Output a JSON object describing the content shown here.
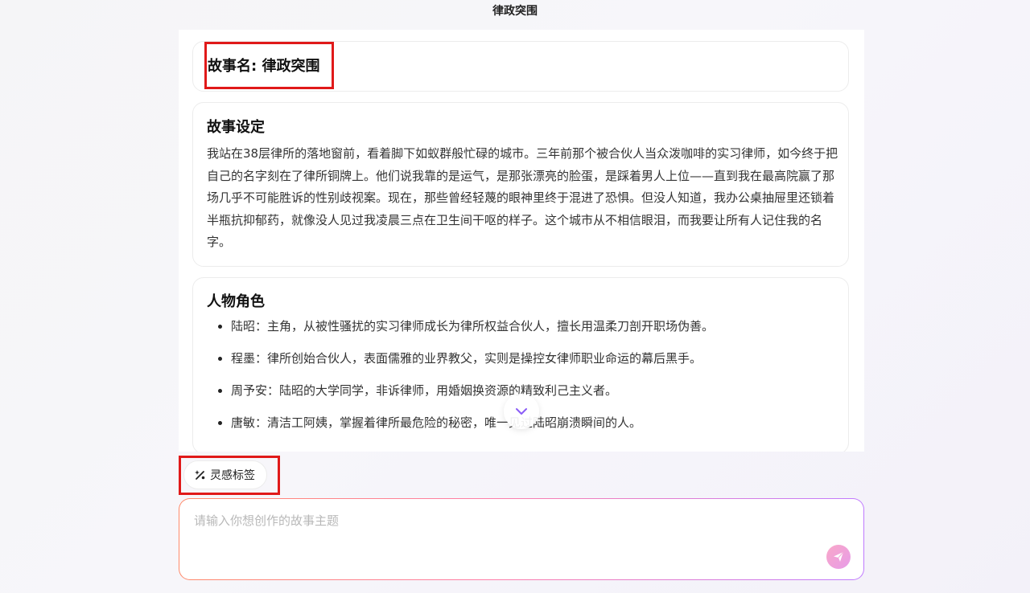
{
  "app": {
    "title": "律政突围"
  },
  "story_name_card": {
    "text": "故事名: 律政突围"
  },
  "setting_card": {
    "heading": "故事设定",
    "body": "我站在38层律所的落地窗前，看着脚下如蚁群般忙碌的城市。三年前那个被合伙人当众泼咖啡的实习律师，如今终于把自己的名字刻在了律所铜牌上。他们说我靠的是运气，是那张漂亮的脸蛋，是踩着男人上位——直到我在最高院赢了那场几乎不可能胜诉的性别歧视案。现在，那些曾经轻蔑的眼神里终于混进了恐惧。但没人知道，我办公桌抽屉里还锁着半瓶抗抑郁药，就像没人见过我凌晨三点在卫生间干呕的样子。这个城市从不相信眼泪，而我要让所有人记住我的名字。"
  },
  "roles_card": {
    "heading": "人物角色",
    "items": [
      {
        "text": "陆昭：主角，从被性骚扰的实习律师成长为律所权益合伙人，擅长用温柔刀剖开职场伪善。"
      },
      {
        "text": "程墨：律所创始合伙人，表面儒雅的业界教父，实则是操控女律师职业命运的幕后黑手。"
      },
      {
        "text": "周予安：陆昭的大学同学，非诉律师，用婚姻换资源的精致利己主义者。"
      },
      {
        "text": "唐敏：清洁工阿姨，掌握着律所最危险的秘密，唯一见过陆昭崩溃瞬间的人。"
      }
    ]
  },
  "scroll_button": {
    "icon": "chevron-down-icon"
  },
  "inspiration_button": {
    "label": "灵感标签",
    "icon": "percent-sparkle-icon"
  },
  "topic_input": {
    "placeholder": "请输入你想创作的故事主题",
    "value": ""
  },
  "send_button": {
    "icon": "send-icon"
  },
  "colors": {
    "highlight_box": "#e01919",
    "accent_gradient_start": "#ff8a6a",
    "accent_gradient_end": "#c07bff",
    "scroll_chevron": "#8a5cf6"
  }
}
